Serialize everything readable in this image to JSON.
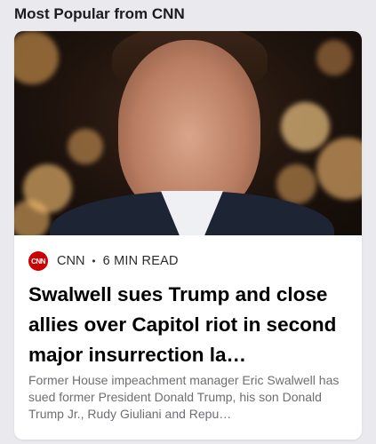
{
  "section": {
    "title": "Most Popular from CNN"
  },
  "article": {
    "logo_text": "CNN",
    "source": "CNN",
    "separator": "•",
    "read_time": "6 MIN READ",
    "headline": "Swalwell sues Trump and close allies over Capitol riot in second major insurrection la…",
    "summary": "Former House impeachment manager Eric Swalwell has sued former President Donald Trump, his son Donald Trump Jr., Rudy Giuliani and Repu…"
  },
  "colors": {
    "background": "#e9e9ee",
    "card": "#ffffff",
    "brand": "#cc0000"
  }
}
